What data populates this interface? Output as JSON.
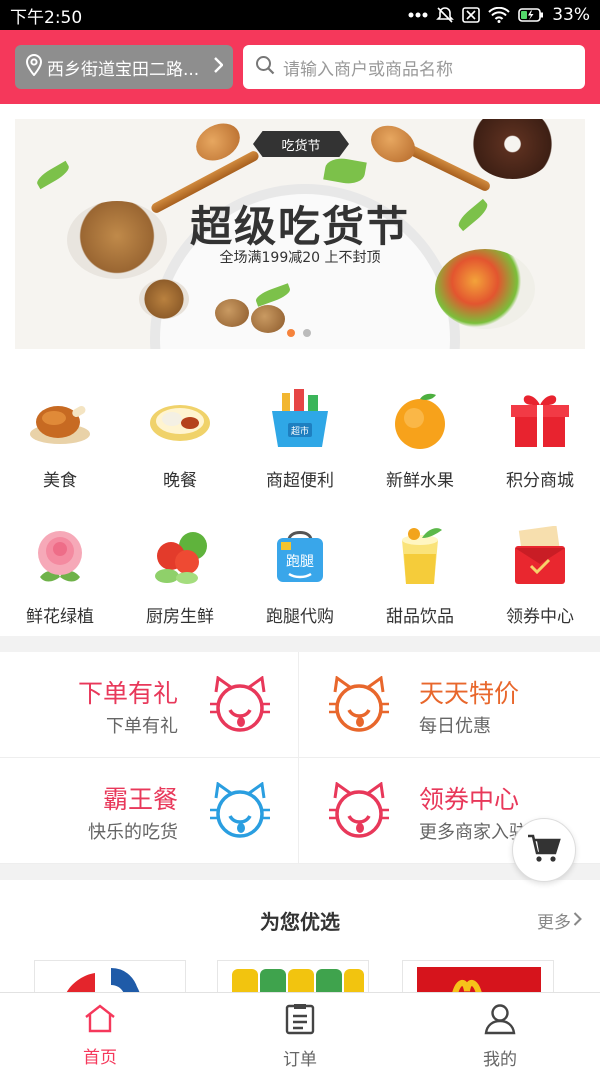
{
  "status_bar": {
    "time": "下午2:50",
    "battery": "33%"
  },
  "header": {
    "location": "西乡街道宝田二路...",
    "search_placeholder": "请输入商户或商品名称"
  },
  "banner": {
    "tag": "吃货节",
    "title": "超级吃货节",
    "subtitle": "全场满199减20 上不封顶",
    "slide_count": 2,
    "active_slide": 1
  },
  "categories": [
    {
      "label": "美食",
      "icon": "roast-chicken-icon"
    },
    {
      "label": "晚餐",
      "icon": "dinner-plate-icon"
    },
    {
      "label": "商超便利",
      "icon": "supermarket-basket-icon"
    },
    {
      "label": "新鲜水果",
      "icon": "orange-icon"
    },
    {
      "label": "积分商城",
      "icon": "gift-box-icon"
    },
    {
      "label": "鲜花绿植",
      "icon": "rose-icon"
    },
    {
      "label": "厨房生鲜",
      "icon": "vegetables-icon"
    },
    {
      "label": "跑腿代购",
      "icon": "errand-bag-icon"
    },
    {
      "label": "甜品饮品",
      "icon": "juice-cup-icon"
    },
    {
      "label": "领券中心",
      "icon": "coupon-envelope-icon"
    }
  ],
  "promos": [
    {
      "title": "下单有礼",
      "subtitle": "下单有礼",
      "color": "#e8385a"
    },
    {
      "title": "天天特价",
      "subtitle": "每日优惠",
      "color": "#e8672c"
    },
    {
      "title": "霸王餐",
      "subtitle": "快乐的吃货",
      "color": "#2a9ee0"
    },
    {
      "title": "领券中心",
      "subtitle": "更多商家入驻",
      "color": "#e8385a"
    }
  ],
  "recommend": {
    "title": "为您优选",
    "more": "更多"
  },
  "bottom_nav": [
    {
      "label": "首页",
      "icon": "home-icon",
      "active": true
    },
    {
      "label": "订单",
      "icon": "order-list-icon",
      "active": false
    },
    {
      "label": "我的",
      "icon": "user-icon",
      "active": false
    }
  ],
  "colors": {
    "brand": "#f5385b",
    "accent_orange": "#f5833c"
  }
}
